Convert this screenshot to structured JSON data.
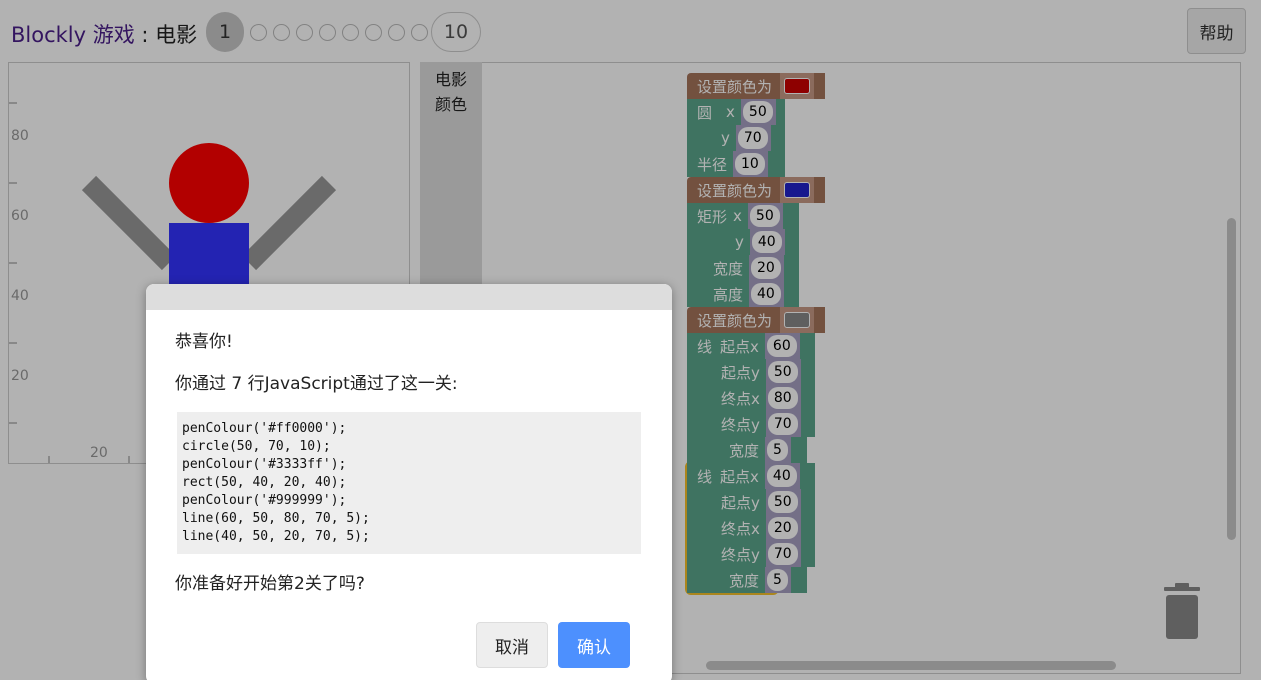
{
  "header": {
    "title_brand": "Blockly 游戏",
    "title_sep": " : ",
    "title_level": "电影",
    "pager": {
      "current": "1",
      "last": "10"
    },
    "help_label": "帮助"
  },
  "display": {
    "y_ticks": [
      "80",
      "60",
      "40",
      "20"
    ],
    "x_ticks": [
      "20"
    ]
  },
  "toolbox": {
    "categories": [
      "电影",
      "颜色"
    ]
  },
  "workspace": {
    "blocks": {
      "set_colour_label": "设置颜色为",
      "circle": {
        "label": "圆",
        "x_label": "x",
        "y_label": "y",
        "r_label": "半径",
        "x": "50",
        "y": "70",
        "r": "10"
      },
      "rect": {
        "label": "矩形",
        "x_label": "x",
        "y_label": "y",
        "w_label": "宽度",
        "h_label": "高度",
        "x": "50",
        "y": "40",
        "w": "20",
        "h": "40"
      },
      "line1": {
        "label": "线",
        "x1_label": "起点x",
        "y1_label": "起点y",
        "x2_label": "终点x",
        "y2_label": "终点y",
        "w_label": "宽度",
        "x1": "60",
        "y1": "50",
        "x2": "80",
        "y2": "70",
        "w": "5"
      },
      "line2": {
        "label": "线",
        "x1_label": "起点x",
        "y1_label": "起点y",
        "x2_label": "终点x",
        "y2_label": "终点y",
        "w_label": "宽度",
        "x1": "40",
        "y1": "50",
        "x2": "20",
        "y2": "70",
        "w": "5"
      }
    },
    "colours": {
      "red": "#cc0000",
      "blue": "#2222cc",
      "grey": "#888888"
    },
    "trash_icon": "trash-icon"
  },
  "dialog": {
    "congrats": "恭喜你!",
    "summary": "你通过 7 行JavaScript通过了这一关:",
    "code": [
      "penColour('#ff0000');",
      "circle(50, 70, 10);",
      "penColour('#3333ff');",
      "rect(50, 40, 20, 40);",
      "penColour('#999999');",
      "line(60, 50, 80, 70, 5);",
      "line(40, 50, 20, 70, 5);"
    ],
    "question": "你准备好开始第2关了吗?",
    "cancel_label": "取消",
    "ok_label": "确认"
  }
}
